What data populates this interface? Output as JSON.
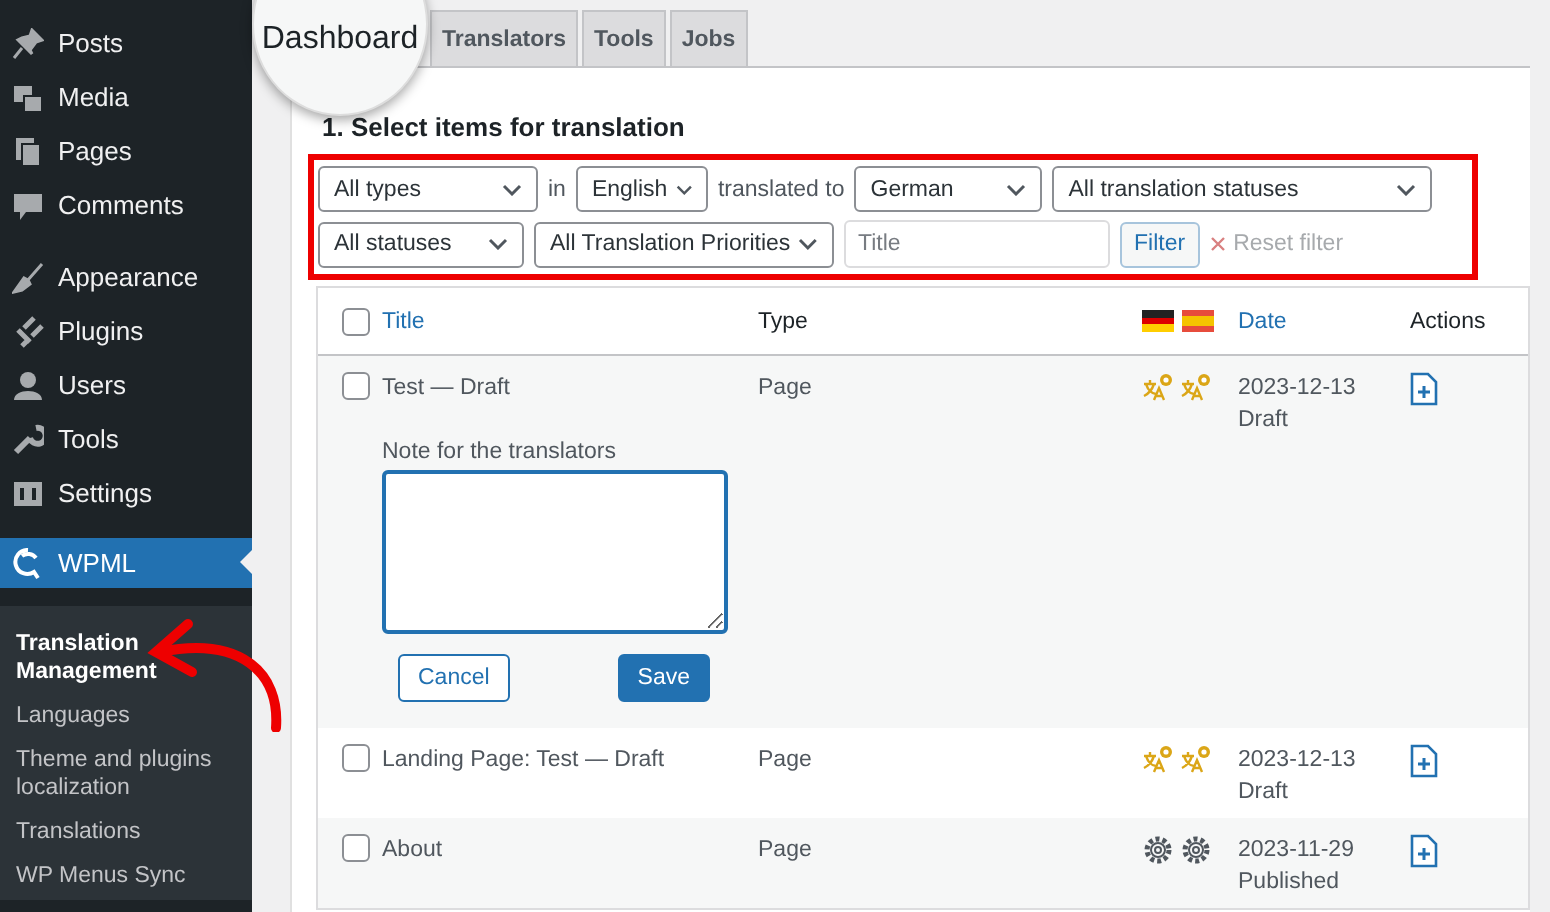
{
  "sidebar": {
    "groups": [
      {
        "items": [
          {
            "label": "Posts",
            "selected": false
          },
          {
            "label": "Media",
            "selected": false
          },
          {
            "label": "Pages",
            "selected": false
          },
          {
            "label": "Comments",
            "selected": false
          }
        ]
      },
      {
        "items": [
          {
            "label": "Appearance",
            "selected": false
          },
          {
            "label": "Plugins",
            "selected": false
          },
          {
            "label": "Users",
            "selected": false
          },
          {
            "label": "Tools",
            "selected": false
          },
          {
            "label": "Settings",
            "selected": false
          }
        ]
      },
      {
        "items": [
          {
            "label": "WPML",
            "selected": true
          }
        ]
      }
    ],
    "submenu": [
      {
        "label": "Translation Management",
        "selected": true
      },
      {
        "label": "Languages",
        "selected": false
      },
      {
        "label": "Theme and plugins localization",
        "selected": false
      },
      {
        "label": "Translations",
        "selected": false
      },
      {
        "label": "WP Menus Sync",
        "selected": false
      }
    ]
  },
  "tabs": [
    {
      "label": "Dashboard",
      "selected": true
    },
    {
      "label": "Translators",
      "selected": false
    },
    {
      "label": "Tools",
      "selected": false
    },
    {
      "label": "Jobs",
      "selected": false
    }
  ],
  "heading": "1. Select items for translation",
  "filters": {
    "lines": [
      {
        "items": [
          {
            "kind": "select",
            "value": "All types"
          },
          {
            "kind": "label",
            "text": "in"
          },
          {
            "kind": "select",
            "value": "English"
          },
          {
            "kind": "label",
            "text": "translated to"
          },
          {
            "kind": "select",
            "value": "German"
          },
          {
            "kind": "select",
            "value": "All translation statuses"
          }
        ]
      },
      {
        "items": [
          {
            "kind": "select",
            "value": "All statuses"
          },
          {
            "kind": "select",
            "value": "All Translation Priorities"
          },
          {
            "kind": "input",
            "placeholder": "Title"
          },
          {
            "kind": "button",
            "label": "Filter"
          },
          {
            "kind": "reset",
            "label": "Reset filter",
            "disabled": true
          }
        ]
      }
    ]
  },
  "table": {
    "columns": {
      "title": "Title",
      "type": "Type",
      "languages": [
        {
          "kind": "german"
        },
        {
          "kind": "spanish"
        }
      ],
      "date": "Date",
      "actions": "Actions"
    },
    "header_checked": false,
    "rows": [
      {
        "checked": false,
        "title": "Test — Draft",
        "type": "Page",
        "statuses": [
          {
            "kind": "needs_translation"
          },
          {
            "kind": "needs_translation"
          }
        ],
        "date": "2023-12-13",
        "status": "Draft",
        "note": {
          "label": "Note for the translators",
          "buttons": [
            {
              "label": "Cancel",
              "kind": "secondary"
            },
            {
              "label": "Save",
              "kind": "primary"
            }
          ]
        }
      },
      {
        "checked": false,
        "title": "Landing Page: Test — Draft",
        "type": "Page",
        "statuses": [
          {
            "kind": "needs_translation"
          },
          {
            "kind": "needs_translation"
          }
        ],
        "date": "2023-12-13",
        "status": "Draft"
      },
      {
        "checked": false,
        "title": "About",
        "type": "Page",
        "statuses": [
          {
            "kind": "in_progress"
          },
          {
            "kind": "in_progress"
          }
        ],
        "date": "2023-11-29",
        "status": "Published"
      }
    ]
  }
}
